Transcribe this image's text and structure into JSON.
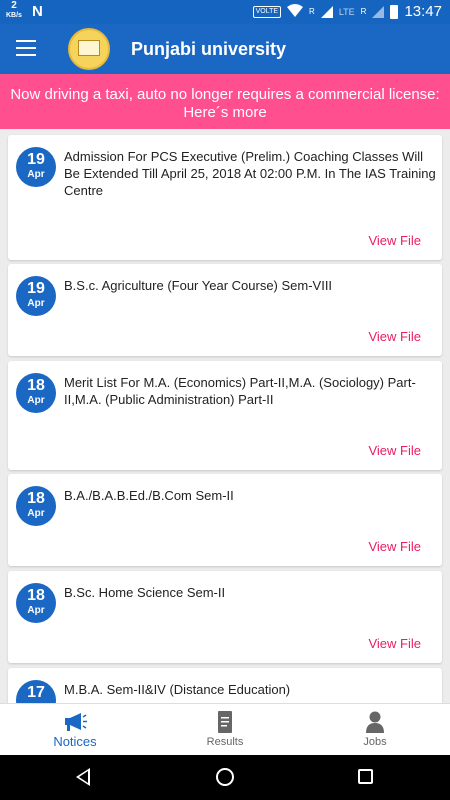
{
  "status_bar": {
    "speed_value": "2",
    "speed_unit": "KB/s",
    "notification_icon": "N",
    "volte": "VOLTE",
    "lte": "LTE",
    "r1": "R",
    "r2": "R",
    "time": "13:47"
  },
  "app_bar": {
    "title": "Punjabi university"
  },
  "banner": {
    "text": "Now driving a taxi, auto no longer requires a commercial license: Here´s more"
  },
  "notices": [
    {
      "day": "19",
      "month": "Apr",
      "title": "Admission For PCS Executive (Prelim.) Coaching Classes Will Be Extended Till April 25, 2018 At 02:00 P.M. In The IAS Training Centre",
      "action": "View File"
    },
    {
      "day": "19",
      "month": "Apr",
      "title": "B.S.c. Agriculture (Four Year Course) Sem-VIII",
      "action": "View File"
    },
    {
      "day": "18",
      "month": "Apr",
      "title": "Merit List For M.A. (Economics) Part-II,M.A. (Sociology) Part-II,M.A. (Public Administration) Part-II",
      "action": "View File"
    },
    {
      "day": "18",
      "month": "Apr",
      "title": "B.A./B.A.B.Ed./B.Com Sem-II",
      "action": "View File"
    },
    {
      "day": "18",
      "month": "Apr",
      "title": "B.Sc. Home Science Sem-II",
      "action": "View File"
    },
    {
      "day": "17",
      "month": "",
      "title": "M.B.A. Sem-II&IV (Distance Education)",
      "action": ""
    }
  ],
  "bottom_nav": {
    "items": [
      {
        "label": "Notices",
        "icon": "megaphone-icon",
        "active": true
      },
      {
        "label": "Results",
        "icon": "document-icon",
        "active": false
      },
      {
        "label": "Jobs",
        "icon": "person-icon",
        "active": false
      }
    ]
  },
  "colors": {
    "primary": "#1a67c4",
    "banner": "#ff4f8e",
    "accent": "#e91e63"
  }
}
